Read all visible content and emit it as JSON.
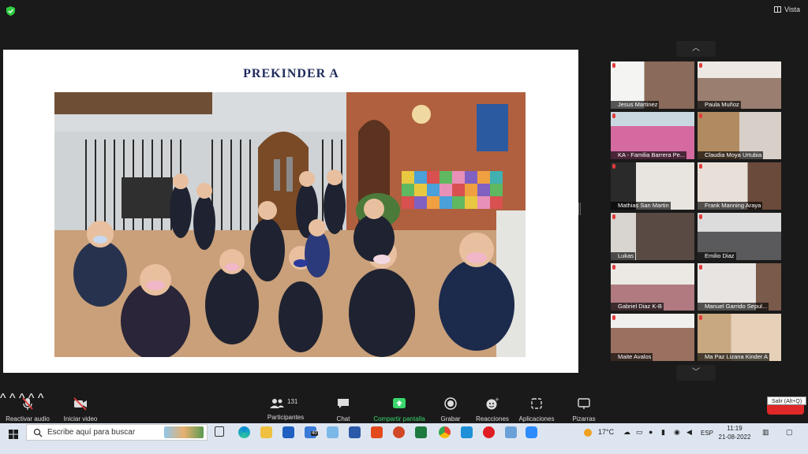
{
  "window": {
    "view_label": "Vista"
  },
  "slide": {
    "title": "PREKINDER  A"
  },
  "gallery": {
    "participants": [
      {
        "name": "Jesus Martinez"
      },
      {
        "name": "Paula Muñoz"
      },
      {
        "name": "KA - Familia Barrera Pe..."
      },
      {
        "name": "Claudia Moya Urtubia"
      },
      {
        "name": "Mathias San Martin"
      },
      {
        "name": "Frank Manning Araya"
      },
      {
        "name": "Lukas"
      },
      {
        "name": "Emilio Diaz"
      },
      {
        "name": "Gabriel Diaz K-B"
      },
      {
        "name": "Manuel Garrido Sepul..."
      },
      {
        "name": "Maite Avalos"
      },
      {
        "name": "Ma Paz Lizana Kinder A"
      }
    ]
  },
  "toolbar": {
    "unmute_label": "Reactivar audio",
    "video_label": "Iniciar video",
    "participants_label": "Participantes",
    "participants_count": "131",
    "chat_label": "Chat",
    "share_label": "Compartir pantalla",
    "record_label": "Grabar",
    "reactions_label": "Reacciones",
    "apps_label": "Aplicaciones",
    "whiteboards_label": "Pizarras",
    "leave_tooltip": "Salir (Alt+Q)"
  },
  "taskbar": {
    "search_placeholder": "Escribe aquí para buscar",
    "mail_badge": "40",
    "weather": "17°C",
    "language": "ESP",
    "time": "11:19",
    "date": "21-08-2022"
  },
  "colors": {
    "accent_green": "#3ad66b",
    "leave_red": "#e02828",
    "mic_muted_red": "#e23b3b",
    "slide_title_navy": "#1f2b5a"
  }
}
